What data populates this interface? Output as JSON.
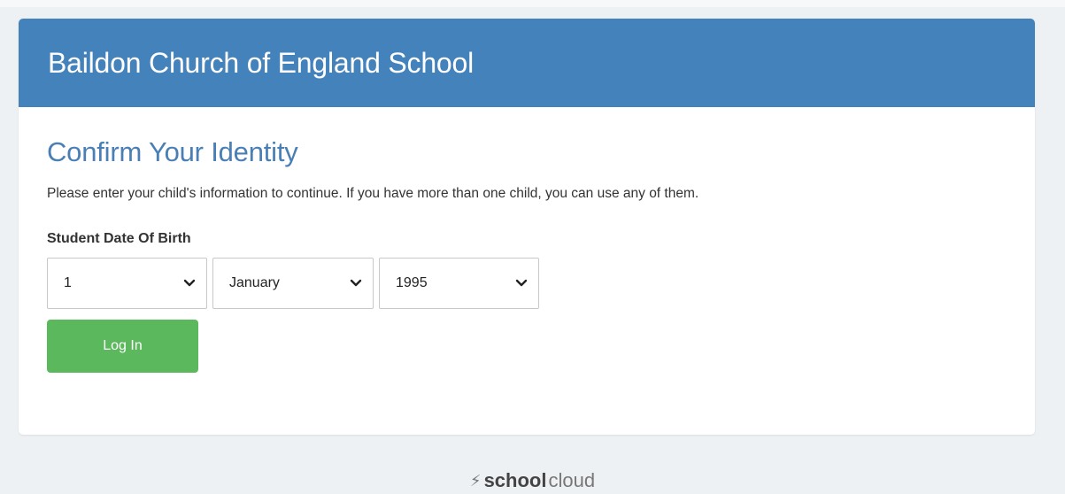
{
  "header": {
    "school_name": "Baildon Church of England School"
  },
  "page": {
    "heading": "Confirm Your Identity",
    "intro": "Please enter your child's information to continue. If you have more than one child, you can use any of them."
  },
  "form": {
    "dob_label": "Student Date Of Birth",
    "day": {
      "selected": "1",
      "icon": "chevron-down-icon"
    },
    "month": {
      "selected": "January",
      "icon": "chevron-down-icon"
    },
    "year": {
      "selected": "1995",
      "icon": "chevron-down-icon"
    },
    "submit_label": "Log In"
  },
  "footer": {
    "brand_icon": "bolt-icon",
    "brand_bold": "school",
    "brand_light": "cloud"
  },
  "colors": {
    "header_bg": "#4482bb",
    "heading": "#4a7fb6",
    "button": "#5cb85c",
    "page_bg": "#eef1f4"
  }
}
